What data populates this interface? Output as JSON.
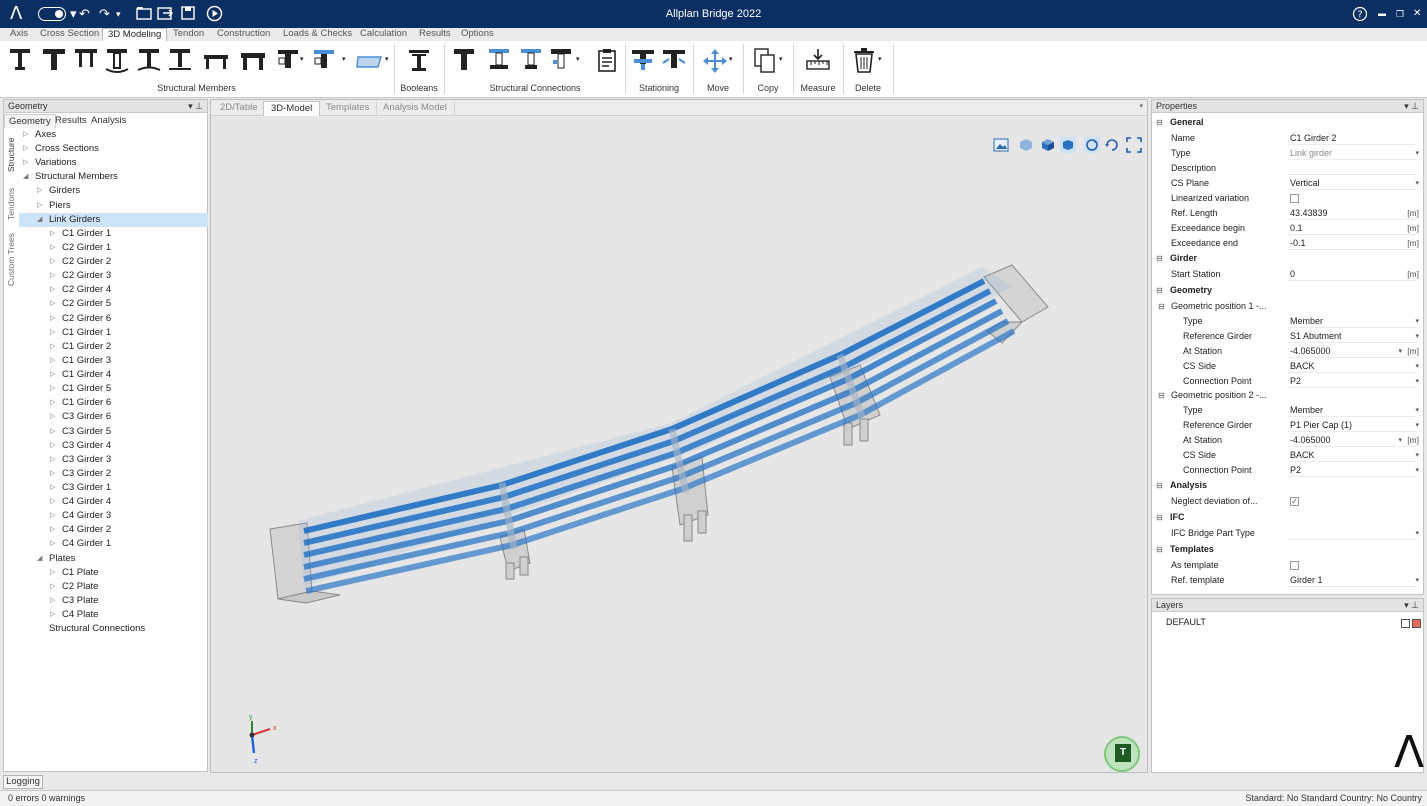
{
  "app": {
    "title": "Allplan Bridge 2022",
    "logo": "Λ"
  },
  "quick_access": {
    "icons": [
      "toggle-icon",
      "undo-icon",
      "redo-icon",
      "folder-icon",
      "export-icon",
      "save-icon",
      "play-icon"
    ]
  },
  "window_buttons": {
    "help": "?",
    "minimize": "▬",
    "restore": "❐",
    "close": "✕"
  },
  "menu_tabs": [
    "Axis",
    "Cross Section",
    "3D Modeling",
    "Tendon",
    "Construction",
    "Loads & Checks",
    "Calculation",
    "Results",
    "Options"
  ],
  "active_menu_tab": "3D Modeling",
  "ribbon": {
    "groups": {
      "structural_members": "Structural Members",
      "booleans": "Booleans",
      "structural_connections": "Structural Connections",
      "stationing": "Stationing",
      "move": "Move",
      "copy": "Copy",
      "measure": "Measure",
      "delete": "Delete"
    }
  },
  "left_panel": {
    "title": "Geometry",
    "tabs": [
      "Geometry",
      "Results",
      "Analysis"
    ],
    "vertical_tabs": [
      "Structure",
      "Tendons",
      "Custom Trees"
    ],
    "tree": [
      {
        "label": "Axes",
        "arrow": "▷"
      },
      {
        "label": "Cross Sections",
        "arrow": "▷"
      },
      {
        "label": "Variations",
        "arrow": "▷"
      },
      {
        "label": "Structural Members",
        "arrow": "◢"
      },
      {
        "label": "Girders",
        "arrow": "▷"
      },
      {
        "label": "Piers",
        "arrow": "▷"
      },
      {
        "label": "Link Girders",
        "arrow": "◢"
      },
      {
        "label": "C1 Girder 1",
        "arrow": "▷"
      },
      {
        "label": "C2 Girder 1",
        "arrow": "▷"
      },
      {
        "label": "C2 Girder 2",
        "arrow": "▷"
      },
      {
        "label": "C2 Girder 3",
        "arrow": "▷"
      },
      {
        "label": "C2 Girder 4",
        "arrow": "▷"
      },
      {
        "label": "C2 Girder 5",
        "arrow": "▷"
      },
      {
        "label": "C2 Girder 6",
        "arrow": "▷"
      },
      {
        "label": "C1 Girder 1",
        "arrow": "▷"
      },
      {
        "label": "C1 Girder 2",
        "arrow": "▷"
      },
      {
        "label": "C1 Girder 3",
        "arrow": "▷"
      },
      {
        "label": "C1 Girder 4",
        "arrow": "▷"
      },
      {
        "label": "C1 Girder 5",
        "arrow": "▷"
      },
      {
        "label": "C1 Girder 6",
        "arrow": "▷"
      },
      {
        "label": "C3 Girder 6",
        "arrow": "▷"
      },
      {
        "label": "C3 Girder 5",
        "arrow": "▷"
      },
      {
        "label": "C3 Girder 4",
        "arrow": "▷"
      },
      {
        "label": "C3 Girder 3",
        "arrow": "▷"
      },
      {
        "label": "C3 Girder 2",
        "arrow": "▷"
      },
      {
        "label": "C3 Girder 1",
        "arrow": "▷"
      },
      {
        "label": "C4 Girder 4",
        "arrow": "▷"
      },
      {
        "label": "C4 Girder 3",
        "arrow": "▷"
      },
      {
        "label": "C4 Girder 2",
        "arrow": "▷"
      },
      {
        "label": "C4 Girder 1",
        "arrow": "▷"
      },
      {
        "label": "Plates",
        "arrow": "◢"
      },
      {
        "label": "C1 Plate",
        "arrow": "▷"
      },
      {
        "label": "C2 Plate",
        "arrow": "▷"
      },
      {
        "label": "C3 Plate",
        "arrow": "▷"
      },
      {
        "label": "C4 Plate",
        "arrow": "▷"
      },
      {
        "label": "Structural Connections",
        "arrow": ""
      }
    ]
  },
  "viewport": {
    "tabs": [
      "2D/Table",
      "3D-Model",
      "Templates",
      "Analysis Model"
    ],
    "active_tab": "3D-Model",
    "toolbar_icons": [
      "picture-icon",
      "cube-flat-icon",
      "cube-shaded-icon",
      "cube-solid-icon",
      "sync-icon",
      "rotate-icon",
      "fit-icon"
    ],
    "axes": {
      "x": "x",
      "y": "y",
      "z": "z"
    },
    "nav_cube_label": "T"
  },
  "properties": {
    "title": "Properties",
    "rows": [
      {
        "type": "cat",
        "key": "General",
        "expander": "⊟"
      },
      {
        "type": "prop",
        "key": "Name",
        "value": "C1 Girder 2"
      },
      {
        "type": "prop",
        "key": "Type",
        "value": "Link girder",
        "readonly": true,
        "dropdown": true
      },
      {
        "type": "prop",
        "key": "Description",
        "value": ""
      },
      {
        "type": "prop",
        "key": "CS Plane",
        "value": "Vertical",
        "dropdown": true
      },
      {
        "type": "prop",
        "key": "Linearized variation",
        "check": ""
      },
      {
        "type": "prop",
        "key": "Ref. Length",
        "value": "43.43839",
        "unit": "[m]"
      },
      {
        "type": "prop",
        "key": "Exceedance begin",
        "value": "0.1",
        "unit": "[m]"
      },
      {
        "type": "prop",
        "key": "Exceedance end",
        "value": "-0.1",
        "unit": "[m]"
      },
      {
        "type": "cat",
        "key": "Girder",
        "expander": "⊟"
      },
      {
        "type": "prop",
        "key": "Start Station",
        "value": "0",
        "unit": "[m]"
      },
      {
        "type": "cat",
        "key": "Geometry",
        "expander": "⊟"
      },
      {
        "type": "sub",
        "key": "Geometric position 1 -...",
        "expander": "⊟"
      },
      {
        "type": "prop2",
        "key": "Type",
        "value": "Member",
        "dropdown": true
      },
      {
        "type": "prop2",
        "key": "Reference Girder",
        "value": "S1 Abutment",
        "dropdown": true
      },
      {
        "type": "prop2",
        "key": "At Station",
        "value": "-4.065000",
        "unit": "[m]",
        "dropdown2": true
      },
      {
        "type": "prop2",
        "key": "CS Side",
        "value": "BACK",
        "dropdown": true
      },
      {
        "type": "prop2",
        "key": "Connection Point",
        "value": "P2",
        "dropdown": true
      },
      {
        "type": "sub",
        "key": "Geometric position 2 -...",
        "expander": "⊟"
      },
      {
        "type": "prop2",
        "key": "Type",
        "value": "Member",
        "dropdown": true
      },
      {
        "type": "prop2",
        "key": "Reference Girder",
        "value": "P1 Pier Cap (1)",
        "dropdown": true
      },
      {
        "type": "prop2",
        "key": "At Station",
        "value": "-4.065000",
        "unit": "[m]",
        "dropdown2": true
      },
      {
        "type": "prop2",
        "key": "CS Side",
        "value": "BACK",
        "dropdown": true
      },
      {
        "type": "prop2",
        "key": "Connection Point",
        "value": "P2",
        "dropdown": true
      },
      {
        "type": "cat",
        "key": "Analysis",
        "expander": "⊟"
      },
      {
        "type": "prop",
        "key": "Neglect deviation of...",
        "check": "✓"
      },
      {
        "type": "cat",
        "key": "IFC",
        "expander": "⊟"
      },
      {
        "type": "prop",
        "key": "IFC Bridge Part Type",
        "value": "",
        "dropdown": true
      },
      {
        "type": "cat",
        "key": "Templates",
        "expander": "⊟"
      },
      {
        "type": "prop",
        "key": "As template",
        "check": ""
      },
      {
        "type": "prop",
        "key": "Ref. template",
        "value": "Girder 1",
        "dropdown": true
      }
    ]
  },
  "layers": {
    "title": "Layers",
    "items": [
      {
        "name": "DEFAULT"
      }
    ]
  },
  "logging": {
    "tab": "Logging"
  },
  "status": {
    "left": "0 errors 0 warnings",
    "right": "Standard: No Standard Country: No Country"
  },
  "colors": {
    "titlebar": "#0b2e63",
    "girder": "#1f6fc4",
    "selection": "#cde4f7"
  }
}
